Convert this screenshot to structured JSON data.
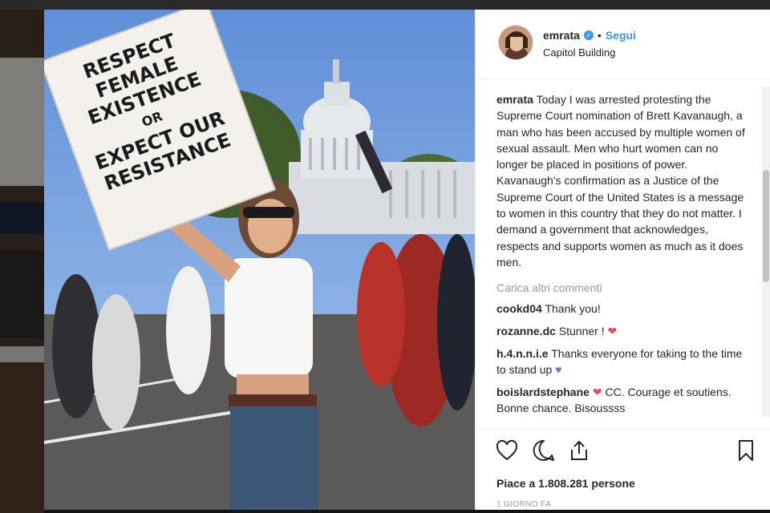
{
  "post": {
    "username": "emrata",
    "follow_label": "Segui",
    "location": "Capitol Building",
    "sign_text": [
      "RESPECT",
      "FEMALE",
      "EXISTENCE",
      "OR",
      "EXPECT OUR",
      "RESISTANCE"
    ],
    "caption_user": "emrata",
    "caption_text": "Today I was arrested protesting the Supreme Court nomination of Brett Kavanaugh, a man who has been accused by multiple women of sexual assault. Men who hurt women can no longer be placed in positions of power. Kavanaugh's confirmation as a Justice of the Supreme Court of the United States is a message to women in this country that they do not matter. I demand a government that acknowledges, respects and supports women as much as it does men.",
    "load_more_label": "Carica altri commenti",
    "comments": [
      {
        "user": "cookd04",
        "text": "Thank you!",
        "emoji": ""
      },
      {
        "user": "rozanne.dc",
        "text": "Stunner !",
        "emoji": "❤"
      },
      {
        "user": "h.4.n.n.i.e",
        "text": "Thanks everyone for taking to the time to stand up",
        "emoji": "♥"
      },
      {
        "user": "boislardstephane",
        "text": "CC. Courage et soutiens. Bonne chance. Bisoussss",
        "emoji": "❤"
      }
    ],
    "likes_text": "Piace a 1.808.281 persone",
    "time_text": "1 GIORNO FA"
  },
  "icons": {
    "like": "heart-outline-icon",
    "comment": "speech-bubble-icon",
    "share": "share-arrow-icon",
    "save": "bookmark-icon",
    "verified": "verified-badge-icon"
  },
  "colors": {
    "link_blue": "#3897f0",
    "text_dark": "#262626",
    "muted": "#999999",
    "heart_red": "#ed4956",
    "heart_purple": "#9b59d0"
  }
}
